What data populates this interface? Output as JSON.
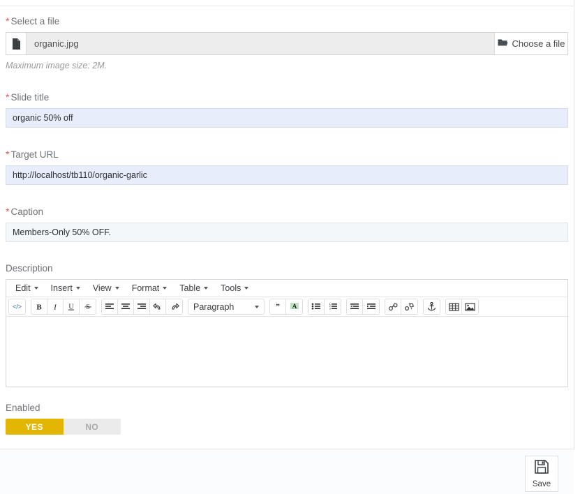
{
  "form": {
    "file_field": {
      "label": "Select a file",
      "required": true,
      "file_icon": "file-page-icon",
      "filename": "organic.jpg",
      "choose_button": "Choose a file",
      "choose_icon": "folder-open-icon",
      "help_text": "Maximum image size: 2M."
    },
    "slide_title": {
      "label": "Slide title",
      "required": true,
      "value": "organic 50% off",
      "placeholder": ""
    },
    "target_url": {
      "label": "Target URL",
      "required": true,
      "value": "http://localhost/tb110/organic-garlic",
      "placeholder": ""
    },
    "caption": {
      "label": "Caption",
      "required": true,
      "value": "Members-Only 50% OFF.",
      "placeholder": ""
    },
    "description": {
      "label": "Description",
      "required": false,
      "body_text": "",
      "menubar": [
        {
          "label": "Edit",
          "name": "menu-edit"
        },
        {
          "label": "Insert",
          "name": "menu-insert"
        },
        {
          "label": "View",
          "name": "menu-view"
        },
        {
          "label": "Format",
          "name": "menu-format"
        },
        {
          "label": "Table",
          "name": "menu-table"
        },
        {
          "label": "Tools",
          "name": "menu-tools"
        }
      ],
      "format_select": "Paragraph",
      "toolbar_groups": [
        [
          "source-code-icon"
        ],
        [
          "bold-icon",
          "italic-icon",
          "underline-icon",
          "strikethrough-icon"
        ],
        [
          "align-left-icon",
          "align-center-icon",
          "align-right-icon",
          "undo-icon",
          "redo-icon"
        ],
        [
          "format-select"
        ],
        [
          "blockquote-icon",
          "text-color-icon"
        ],
        [
          "bullet-list-icon",
          "numbered-list-icon"
        ],
        [
          "outdent-icon",
          "indent-icon"
        ],
        [
          "link-icon",
          "unlink-icon"
        ],
        [
          "anchor-icon"
        ],
        [
          "media-icon",
          "image-icon"
        ]
      ]
    },
    "enabled": {
      "label": "Enabled",
      "yes_label": "YES",
      "no_label": "NO",
      "selected": "YES"
    }
  },
  "footer": {
    "save_label": "Save",
    "save_icon": "floppy-disk-icon"
  },
  "colors": {
    "required_asterisk": "#e8544e",
    "toggle_active": "#e3b505",
    "autofill_background": "#e8edfb",
    "plain_input_background": "#f4f7f9"
  }
}
